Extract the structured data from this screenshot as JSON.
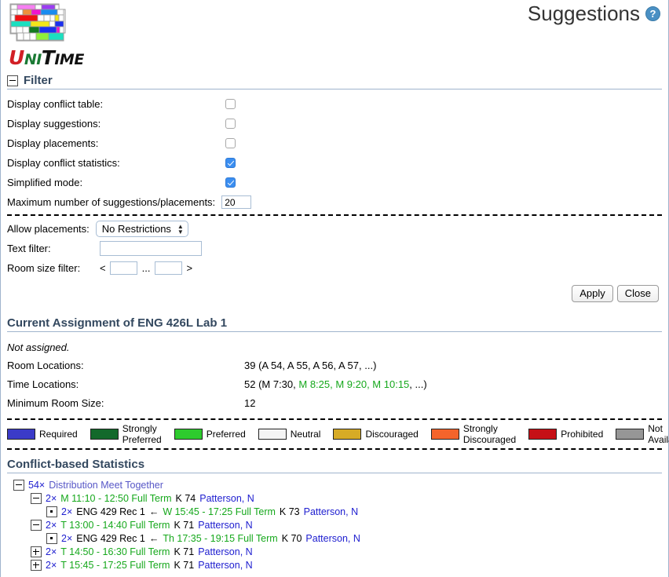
{
  "header": {
    "title": "Suggestions",
    "help_icon": "help-circle-icon",
    "logo_word_u": "U",
    "logo_word_ni": "NI",
    "logo_word_t": "T",
    "logo_word_ime": "IME"
  },
  "filter": {
    "section_label": "Filter",
    "checkboxes": [
      {
        "label": "Display conflict table:",
        "checked": false,
        "name": "display-conflict-table"
      },
      {
        "label": "Display suggestions:",
        "checked": false,
        "name": "display-suggestions"
      },
      {
        "label": "Display placements:",
        "checked": false,
        "name": "display-placements"
      },
      {
        "label": "Display conflict statistics:",
        "checked": true,
        "name": "display-conflict-statistics"
      },
      {
        "label": "Simplified mode:",
        "checked": true,
        "name": "simplified-mode"
      }
    ],
    "max_suggestions_label": "Maximum number of suggestions/placements:",
    "max_suggestions_value": "20",
    "allow_placements_label": "Allow placements:",
    "allow_placements_value": "No Restrictions",
    "text_filter_label": "Text filter:",
    "text_filter_value": "",
    "room_size_label": "Room size filter:",
    "room_size_lt": "<",
    "room_size_min": "",
    "room_size_ellipsis": "...",
    "room_size_max": "",
    "room_size_gt": ">",
    "apply_label": "Apply",
    "close_label": "Close"
  },
  "assignment": {
    "heading": "Current Assignment of ENG 426L Lab 1",
    "status": "Not assigned.",
    "rows": [
      {
        "label": "Room Locations:",
        "value": "39 (A 54, A 55, A 56, A 57, ...)"
      },
      {
        "label": "Minimum Room Size:",
        "value": "12"
      }
    ],
    "time_locations_label": "Time Locations:",
    "time_locations_prefix": "52 (M 7:30, ",
    "time_locations_green": "M 8:25, M 9:20, M 10:15",
    "time_locations_suffix": ", ...)"
  },
  "legend": [
    {
      "label": "Required",
      "color": "#3b3bc8"
    },
    {
      "label": "Strongly Preferred",
      "color": "#13692b"
    },
    {
      "label": "Preferred",
      "color": "#2ecb2e"
    },
    {
      "label": "Neutral",
      "color": "#f4f4f4"
    },
    {
      "label": "Discouraged",
      "color": "#d7ab26"
    },
    {
      "label": "Strongly Discouraged",
      "color": "#f4642b"
    },
    {
      "label": "Prohibited",
      "color": "#c61016"
    },
    {
      "label": "Not Available",
      "color": "#969696"
    }
  ],
  "stats": {
    "heading": "Conflict-based Statistics",
    "nodes": [
      {
        "level": 1,
        "toggle": "minus",
        "count": "54×",
        "parts": [
          {
            "text": "Distribution Meet Together",
            "color": "link"
          }
        ]
      },
      {
        "level": 2,
        "toggle": "minus",
        "count": "2×",
        "parts": [
          {
            "text": "M 11:10 - 12:50 Full Term",
            "color": "green"
          },
          {
            "text": "K 74",
            "color": "black"
          },
          {
            "text": "Patterson, N",
            "color": "blue"
          }
        ]
      },
      {
        "level": 3,
        "toggle": "leaf",
        "count": "2×",
        "parts": [
          {
            "text": "ENG 429 Rec 1",
            "color": "black"
          },
          {
            "text": "←",
            "color": "black"
          },
          {
            "text": "W 15:45 - 17:25 Full Term",
            "color": "green"
          },
          {
            "text": "K 73",
            "color": "black"
          },
          {
            "text": "Patterson, N",
            "color": "blue"
          }
        ]
      },
      {
        "level": 2,
        "toggle": "minus",
        "count": "2×",
        "parts": [
          {
            "text": "T 13:00 - 14:40 Full Term",
            "color": "green"
          },
          {
            "text": "K 71",
            "color": "black"
          },
          {
            "text": "Patterson, N",
            "color": "blue"
          }
        ]
      },
      {
        "level": 3,
        "toggle": "leaf",
        "count": "2×",
        "parts": [
          {
            "text": "ENG 429 Rec 1",
            "color": "black"
          },
          {
            "text": "←",
            "color": "black"
          },
          {
            "text": "Th 17:35 - 19:15 Full Term",
            "color": "green"
          },
          {
            "text": "K 70",
            "color": "black"
          },
          {
            "text": "Patterson, N",
            "color": "blue"
          }
        ]
      },
      {
        "level": 2,
        "toggle": "plus",
        "count": "2×",
        "parts": [
          {
            "text": "T 14:50 - 16:30 Full Term",
            "color": "green"
          },
          {
            "text": "K 71",
            "color": "black"
          },
          {
            "text": "Patterson, N",
            "color": "blue"
          }
        ]
      },
      {
        "level": 2,
        "toggle": "plus",
        "count": "2×",
        "parts": [
          {
            "text": "T 15:45 - 17:25 Full Term",
            "color": "green"
          },
          {
            "text": "K 71",
            "color": "black"
          },
          {
            "text": "Patterson, N",
            "color": "blue"
          }
        ]
      }
    ]
  },
  "logo_grid": {
    "rows": [
      [
        {
          "c": "#ffffff",
          "w": 10
        },
        {
          "c": "#f77ff2",
          "w": 28
        },
        {
          "c": "#ffffff",
          "w": 10
        },
        {
          "c": "#9b3cf2",
          "w": 22
        },
        {
          "c": "#ffffff",
          "w": 12
        }
      ],
      [
        {
          "c": "#ffffff",
          "w": 10
        },
        {
          "c": "#ffffff",
          "w": 10
        },
        {
          "c": "#ef8f3a",
          "w": 14
        },
        {
          "c": "#ef13ce",
          "w": 14
        },
        {
          "c": "#1a8cf0",
          "w": 22
        },
        {
          "c": "#ffffff",
          "w": 12
        }
      ],
      [
        {
          "c": "#ffffff",
          "w": 8
        },
        {
          "c": "#ee1111",
          "w": 34
        },
        {
          "c": "#ffffff",
          "w": 10
        },
        {
          "c": "#ffffff",
          "w": 10
        },
        {
          "c": "#ffffff",
          "w": 10
        }
      ],
      [
        {
          "c": "#1ae0c0",
          "w": 26
        },
        {
          "c": "#f2e61a",
          "w": 26
        },
        {
          "c": "#ffffff",
          "w": 10
        },
        {
          "c": "#ffffff",
          "w": 10
        }
      ],
      [
        {
          "c": "#ffffff",
          "w": 10
        },
        {
          "c": "#ffffff",
          "w": 10
        },
        {
          "c": "#127a20",
          "w": 16
        },
        {
          "c": "#1a2ff0",
          "w": 26
        },
        {
          "c": "#ffffff",
          "w": 8
        }
      ],
      [
        {
          "c": "#ffffff",
          "w": 24
        },
        {
          "c": "#8ef23a",
          "w": 20
        },
        {
          "c": "#1ae0c0",
          "w": 28
        }
      ]
    ]
  }
}
